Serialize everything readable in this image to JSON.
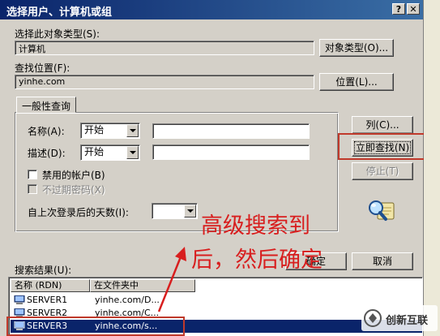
{
  "window": {
    "title": "选择用户、计算机或组",
    "help_btn": "?",
    "close_btn": "✕"
  },
  "object_type": {
    "label": "选择此对象类型(S):",
    "value": "计算机",
    "button": "对象类型(O)..."
  },
  "location": {
    "label": "查找位置(F):",
    "value": "yinhe.com",
    "button": "位置(L)..."
  },
  "tab": {
    "label": "一般性查询"
  },
  "query": {
    "name_label": "名称(A):",
    "name_mode": "开始",
    "name_value": "",
    "desc_label": "描述(D):",
    "desc_mode": "开始",
    "desc_value": "",
    "disabled_accounts_label": "禁用的帐户(B)",
    "nonexpiring_pw_label": "不过期密码(X)",
    "days_label": "自上次登录后的天数(I):",
    "days_value": ""
  },
  "side_buttons": {
    "columns": "列(C)...",
    "find_now": "立即查找(N)",
    "stop": "停止(T)"
  },
  "results": {
    "label": "搜索结果(U):",
    "columns": [
      "名称 (RDN)",
      "在文件夹中"
    ],
    "rows": [
      {
        "name": "SERVER1",
        "folder": "yinhe.com/D...",
        "selected": false
      },
      {
        "name": "SERVER2",
        "folder": "yinhe.com/C...",
        "selected": false
      },
      {
        "name": "SERVER3",
        "folder": "yinhe.com/s...",
        "selected": true
      }
    ]
  },
  "dialog_buttons": {
    "ok": "确定",
    "cancel": "取消"
  },
  "annotation": {
    "line1": "高级搜索到",
    "line2": "后，然后确定",
    "color": "#d81e1e"
  },
  "watermark": {
    "text": "创新互联"
  }
}
